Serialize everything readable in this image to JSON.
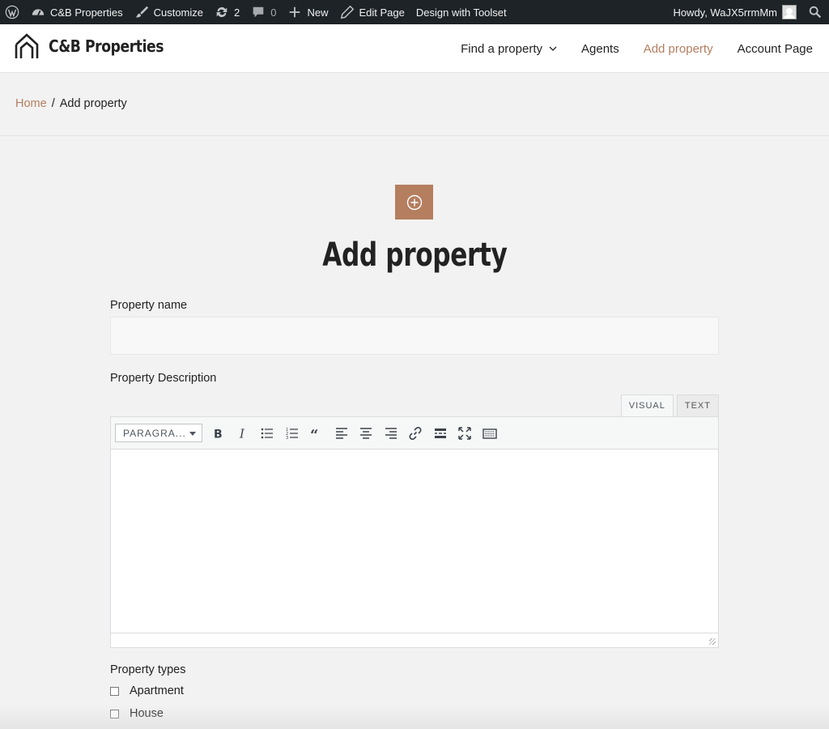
{
  "adminbar": {
    "wp_logo_icon": "wordpress-icon",
    "site_name": "C&B Properties",
    "customize": "Customize",
    "updates_count": "2",
    "comments_count": "0",
    "new": "New",
    "edit_page": "Edit Page",
    "toolset": "Design with Toolset",
    "howdy": "Howdy, WaJX5rrmMm"
  },
  "header": {
    "logo_text": "C&B Properties",
    "nav": [
      {
        "label": "Find a property"
      },
      {
        "label": "Agents"
      },
      {
        "label": "Add property"
      },
      {
        "label": "Account Page"
      }
    ],
    "accent": "#b47e5f"
  },
  "breadcrumb": {
    "home": "Home",
    "separator": "/",
    "current": "Add property"
  },
  "page": {
    "title": "Add property",
    "property_name_label": "Property name",
    "property_name_value": "",
    "description_label": "Property Description",
    "tab_visual": "VISUAL",
    "tab_text": "TEXT",
    "format_select": "PARAGRA...",
    "property_types_label": "Property types",
    "types": [
      {
        "label": "Apartment",
        "checked": false
      },
      {
        "label": "House",
        "checked": false
      }
    ]
  }
}
